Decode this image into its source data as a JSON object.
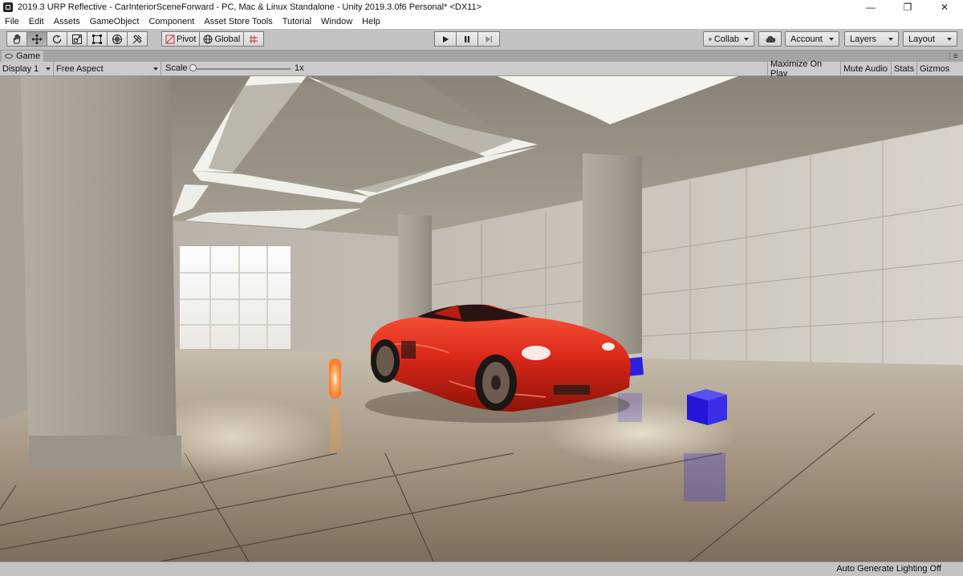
{
  "window": {
    "title": "2019.3 URP Reflective - CarInteriorSceneForward - PC, Mac & Linux Standalone - Unity 2019.3.0f6 Personal* <DX11>",
    "app_icon": "unity-icon",
    "controls": {
      "minimize": "—",
      "maximize": "❐",
      "close": "✕"
    }
  },
  "menu": [
    "File",
    "Edit",
    "Assets",
    "GameObject",
    "Component",
    "Asset Store Tools",
    "Tutorial",
    "Window",
    "Help"
  ],
  "toolbar": {
    "tools": [
      "hand-tool-icon",
      "move-tool-icon",
      "rotate-tool-icon",
      "scale-tool-icon",
      "rect-tool-icon",
      "transform-tool-icon",
      "custom-tool-icon"
    ],
    "active_tool": "move-tool-icon",
    "pivot": "Pivot",
    "global": "Global",
    "play_controls": [
      "play-icon",
      "pause-icon",
      "step-icon"
    ],
    "collab": "Collab",
    "account": "Account",
    "layers": "Layers",
    "layout": "Layout"
  },
  "game_tab": {
    "label": "Game"
  },
  "game_bar": {
    "display": "Display 1",
    "aspect": "Free Aspect",
    "scale_label": "Scale",
    "scale_value": "1x",
    "maximize": "Maximize On Play",
    "mute": "Mute Audio",
    "stats": "Stats",
    "gizmos": "Gizmos"
  },
  "status": {
    "text": "Auto Generate Lighting Off"
  },
  "colors": {
    "car": "#d8281a",
    "cube": "#2a1ee0",
    "light": "#ff9a3a",
    "toolbar": "#c2c2c2"
  }
}
